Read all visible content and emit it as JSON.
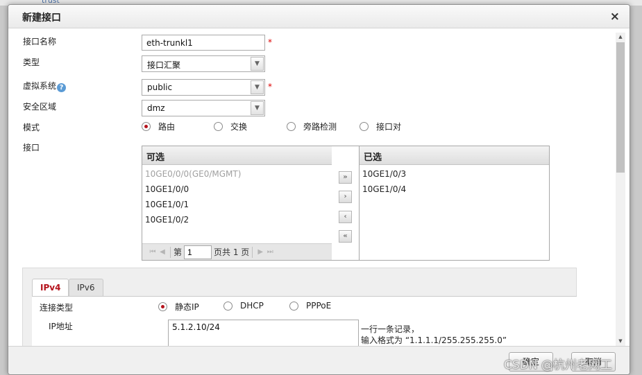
{
  "background": {
    "text": "trust"
  },
  "dialog": {
    "title": "新建接口",
    "close_symbol": "×"
  },
  "form": {
    "name_label": "接口名称",
    "name_value": "eth-trunkl1",
    "required_mark": "*",
    "type_label": "类型",
    "type_value": "接口汇聚",
    "vsys_label": "虚拟系统",
    "vsys_value": "public",
    "zone_label": "安全区域",
    "zone_value": "dmz",
    "mode_label": "模式",
    "mode_options": [
      {
        "label": "路由",
        "selected": true
      },
      {
        "label": "交换",
        "selected": false
      },
      {
        "label": "旁路检测",
        "selected": false
      },
      {
        "label": "接口对",
        "selected": false
      }
    ],
    "interface_label": "接口"
  },
  "available": {
    "header": "可选",
    "items": [
      {
        "label": "10GE0/0/0(GE0/MGMT)",
        "disabled": true
      },
      {
        "label": "10GE1/0/0",
        "disabled": false
      },
      {
        "label": "10GE1/0/1",
        "disabled": false
      },
      {
        "label": "10GE1/0/2",
        "disabled": false
      }
    ],
    "pager": {
      "page_prefix": "第",
      "page_value": "1",
      "page_total": "页共 1 页"
    }
  },
  "selected": {
    "header": "已选",
    "items": [
      {
        "label": "10GE1/0/3"
      },
      {
        "label": "10GE1/0/4"
      }
    ]
  },
  "transfer_buttons": {
    "add_all": "»",
    "add": "›",
    "remove": "‹",
    "remove_all": "«"
  },
  "ip_panel": {
    "tabs": [
      {
        "label": "IPv4",
        "active": true
      },
      {
        "label": "IPv6",
        "active": false
      }
    ],
    "conn_type_label": "连接类型",
    "conn_options": [
      {
        "label": "静态IP",
        "selected": true
      },
      {
        "label": "DHCP",
        "selected": false
      },
      {
        "label": "PPPoE",
        "selected": false
      }
    ],
    "ip_label": "IP地址",
    "ip_value": "5.1.2.10/24",
    "hint_line1": "一行一条记录，",
    "hint_line2": "输入格式为 “1.1.1.1/255.255.255.0”"
  },
  "footer": {
    "ok_label": "确定",
    "cancel_label": "取消"
  },
  "watermark": "CSDN @杭州老网工",
  "colors": {
    "accent_red": "#b5121b",
    "help_blue": "#5b9bd5"
  },
  "icons": {
    "help": "question-circle-icon",
    "dropdown": "chevron-down-icon"
  }
}
